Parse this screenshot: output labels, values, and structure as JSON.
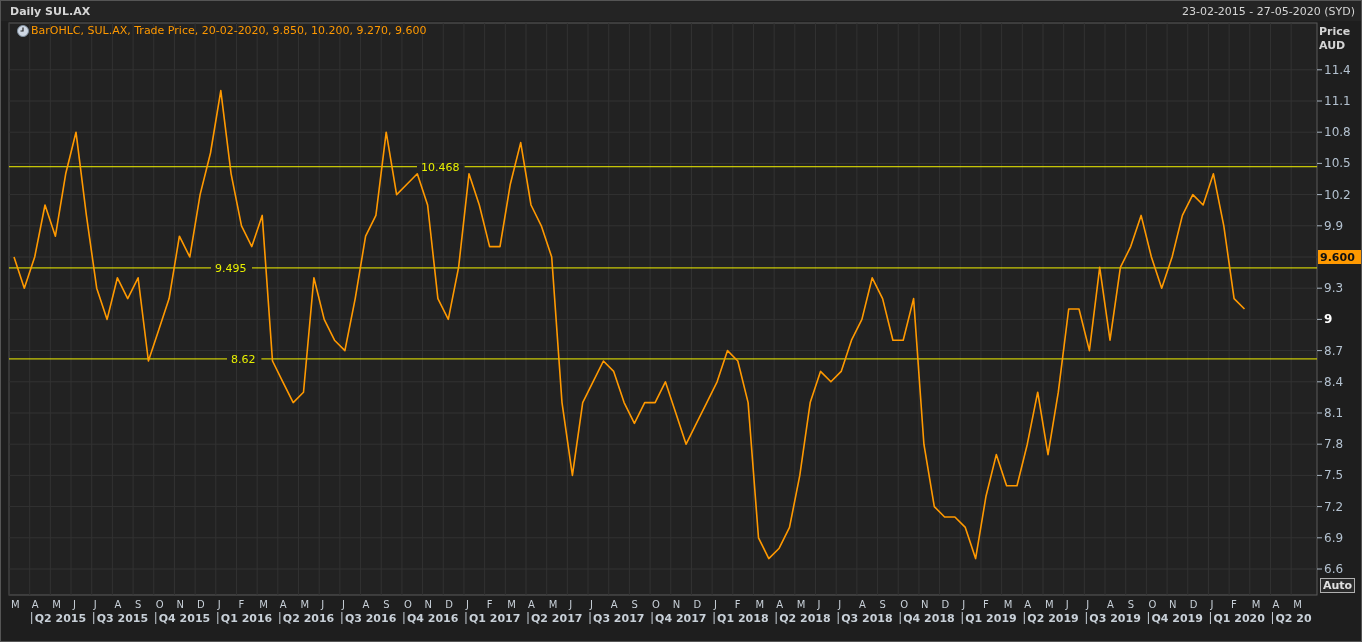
{
  "header": {
    "title": "Daily SUL.AX",
    "date_range": "23-02-2015 - 27-05-2020 (SYD)"
  },
  "legend": "BarOHLC, SUL.AX, Trade Price, 20-02-2020, 9.850, 10.200, 9.270, 9.600",
  "axis_title": [
    "Price",
    "AUD"
  ],
  "last_price": "9.600",
  "auto_button": "Auto",
  "x_axis": {
    "trailing_months": [
      "M",
      "A",
      "M"
    ],
    "quarters": [
      "Q2 2015",
      "Q3 2015",
      "Q4 2015",
      "Q1 2016",
      "Q2 2016",
      "Q3 2016",
      "Q4 2016",
      "Q1 2017",
      "Q2 2017",
      "Q3 2017",
      "Q4 2017",
      "Q1 2018",
      "Q2 2018",
      "Q3 2018",
      "Q4 2018",
      "Q1 2019",
      "Q2 2019",
      "Q3 2019",
      "Q4 2019",
      "Q1 2020",
      "Q2 20"
    ]
  },
  "chart_data": {
    "type": "line",
    "grid": true,
    "ylim": [
      6.35,
      11.85
    ],
    "yticks": [
      6.6,
      6.9,
      7.2,
      7.5,
      7.8,
      8.1,
      8.4,
      8.7,
      {
        "value": 9,
        "label": "9"
      },
      9.3,
      9.9,
      10.2,
      10.5,
      10.8,
      11.1,
      11.4
    ],
    "categories": [
      "M",
      null,
      "A",
      null,
      "M",
      null,
      "J",
      null,
      "J",
      null,
      "A",
      null,
      "S",
      null,
      "O",
      null,
      "N",
      null,
      "D",
      null,
      "J",
      null,
      "F",
      null,
      "M",
      null,
      "A",
      null,
      "M",
      null,
      "J",
      null,
      "J",
      null,
      "A",
      null,
      "S",
      null,
      "O",
      null,
      "N",
      null,
      "D",
      null,
      "J",
      null,
      "F",
      null,
      "M",
      null,
      "A",
      null,
      "M",
      null,
      "J",
      null,
      "J",
      null,
      "A",
      null,
      "S",
      null,
      "O",
      null,
      "N",
      null,
      "D",
      null,
      "J",
      null,
      "F",
      null,
      "M",
      null,
      "A",
      null,
      "M",
      null,
      "J",
      null,
      "J",
      null,
      "A",
      null,
      "S",
      null,
      "O",
      null,
      "N",
      null,
      "D",
      null,
      "J",
      null,
      "F",
      null,
      "M",
      null,
      "A",
      null,
      "M",
      null,
      "J",
      null,
      "J",
      null,
      "A",
      null,
      "S",
      null,
      "O",
      null,
      "N",
      null,
      "D",
      null,
      "J",
      null,
      "F",
      null
    ],
    "series": [
      {
        "color": "#ff9900",
        "values": [
          9.6,
          9.3,
          9.6,
          10.1,
          9.8,
          10.4,
          10.8,
          10.0,
          9.3,
          9.0,
          9.4,
          9.2,
          9.4,
          8.6,
          8.9,
          9.2,
          9.8,
          9.6,
          10.2,
          10.6,
          11.2,
          10.4,
          9.9,
          9.7,
          10.0,
          8.6,
          8.4,
          8.2,
          8.3,
          9.4,
          9.0,
          8.8,
          8.7,
          9.2,
          9.8,
          10.0,
          10.8,
          10.2,
          10.3,
          10.4,
          10.1,
          9.2,
          9.0,
          9.5,
          10.4,
          10.1,
          9.7,
          9.7,
          10.3,
          10.7,
          10.1,
          9.9,
          9.6,
          8.2,
          7.5,
          8.2,
          8.4,
          8.6,
          8.5,
          8.2,
          8.0,
          8.2,
          8.2,
          8.4,
          8.1,
          7.8,
          8.0,
          8.2,
          8.4,
          8.7,
          8.6,
          8.2,
          6.9,
          6.7,
          6.8,
          7.0,
          7.5,
          8.2,
          8.5,
          8.4,
          8.5,
          8.8,
          9.0,
          9.4,
          9.2,
          8.8,
          8.8,
          9.2,
          7.8,
          7.2,
          7.1,
          7.1,
          7.0,
          6.7,
          7.3,
          7.7,
          7.4,
          7.4,
          7.8,
          8.3,
          7.7,
          8.3,
          9.1,
          9.1,
          8.7,
          9.5,
          8.8,
          9.5,
          9.7,
          10.0,
          9.6,
          9.3,
          9.6,
          10.0,
          10.2,
          10.1,
          10.4,
          9.9,
          9.2,
          9.1
        ]
      }
    ],
    "ref_lines": [
      {
        "axis": "y",
        "value": 10.468,
        "label": "10.468"
      },
      {
        "axis": "y",
        "value": 9.495,
        "label": "9.495"
      },
      {
        "axis": "y",
        "value": 8.62,
        "label": "8.62"
      }
    ]
  }
}
